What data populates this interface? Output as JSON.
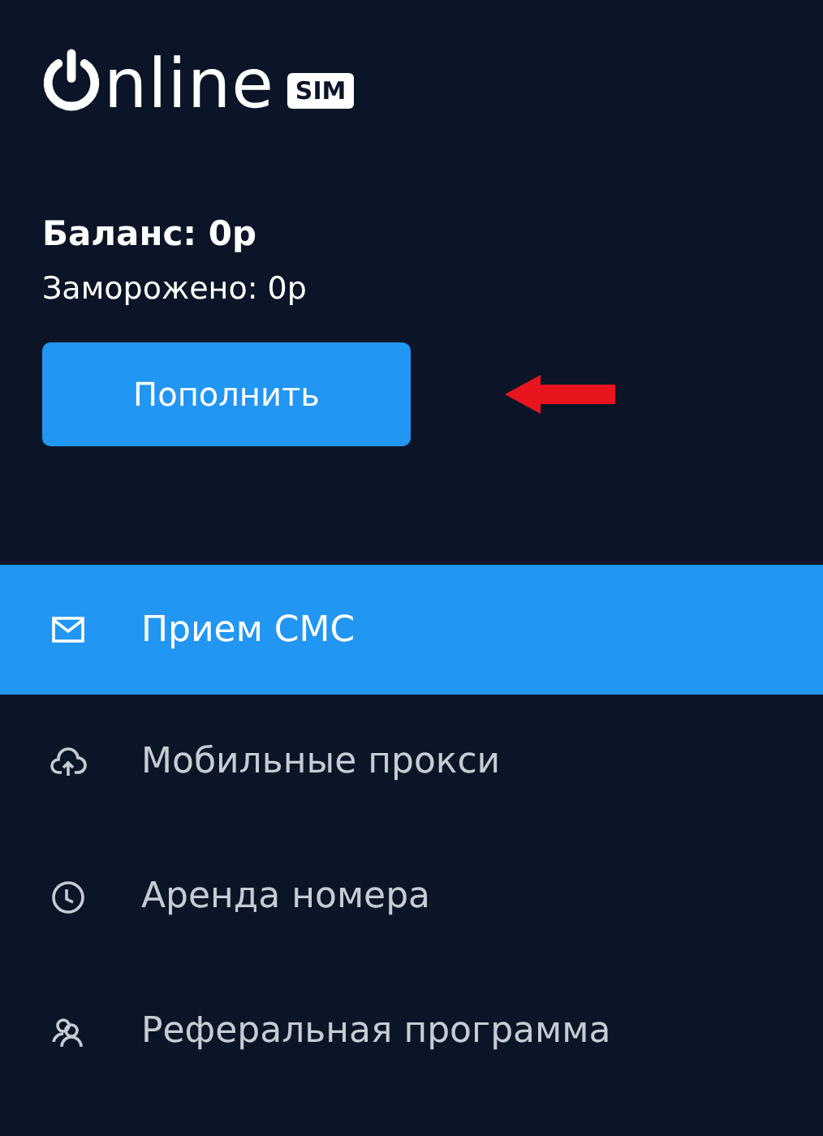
{
  "logo": {
    "text": "nline",
    "badge": "SIM"
  },
  "balance": {
    "label": "Баланс: 0р",
    "frozen": "Заморожено: 0р"
  },
  "topup_button": {
    "label": "Пополнить"
  },
  "menu": [
    {
      "label": "Прием СМС",
      "kind": "mail",
      "selected": true
    },
    {
      "label": "Мобильные прокси",
      "kind": "cloud",
      "selected": false
    },
    {
      "label": "Аренда номера",
      "kind": "clock",
      "selected": false
    },
    {
      "label": "Реферальная программа",
      "kind": "people",
      "selected": false
    }
  ]
}
